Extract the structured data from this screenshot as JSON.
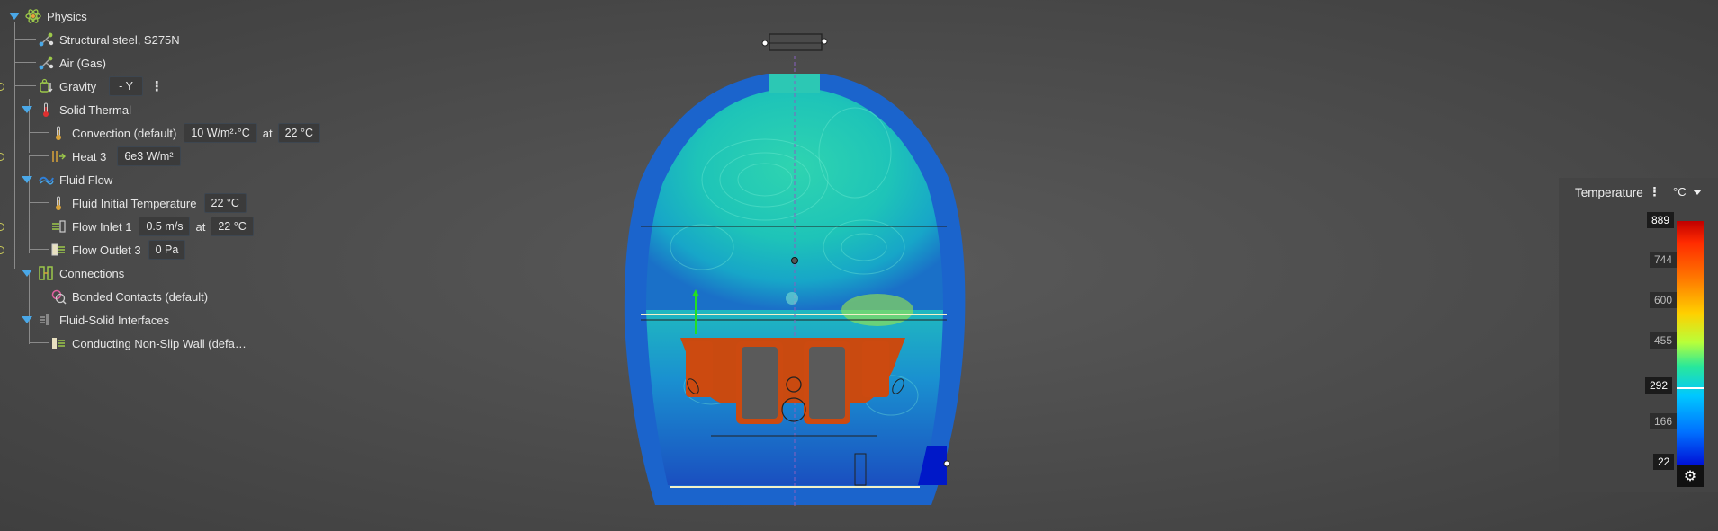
{
  "tree": {
    "physics": "Physics",
    "material_steel": "Structural steel, S275N",
    "material_air": "Air (Gas)",
    "gravity": {
      "label": "Gravity",
      "value": "- Y"
    },
    "solid_thermal": "Solid Thermal",
    "convection": {
      "label": "Convection (default)",
      "value": "10 W/m²·°C",
      "at": "at",
      "temp": "22 °C"
    },
    "heat": {
      "label": "Heat 3",
      "value": "6e3 W/m²"
    },
    "fluid_flow": "Fluid Flow",
    "fluid_initial_temp": {
      "label": "Fluid Initial Temperature",
      "value": "22 °C"
    },
    "flow_inlet": {
      "label": "Flow Inlet 1",
      "value": "0.5 m/s",
      "at": "at",
      "temp": "22 °C"
    },
    "flow_outlet": {
      "label": "Flow Outlet 3",
      "value": "0 Pa"
    },
    "connections": "Connections",
    "bonded_contacts": "Bonded Contacts (default)",
    "fluid_solid": "Fluid-Solid Interfaces",
    "conducting_wall": "Conducting Non-Slip Wall (defa…"
  },
  "legend": {
    "title": "Temperature",
    "unit": "°C",
    "ticks": [
      "889",
      "744",
      "600",
      "455",
      "292",
      "166",
      "22"
    ],
    "highlighted": [
      "889",
      "292",
      "22"
    ]
  },
  "icons": {
    "physics": "atom-icon",
    "material": "molecule-icon",
    "gravity": "gravity-icon",
    "thermometer": "thermometer-icon",
    "heat": "heat-flux-icon",
    "fluid": "wave-icon",
    "inlet": "flow-inlet-icon",
    "outlet": "flow-outlet-icon",
    "connections": "connections-icon",
    "contacts": "contact-icon",
    "interface": "interface-icon",
    "settings": "gear-icon"
  }
}
